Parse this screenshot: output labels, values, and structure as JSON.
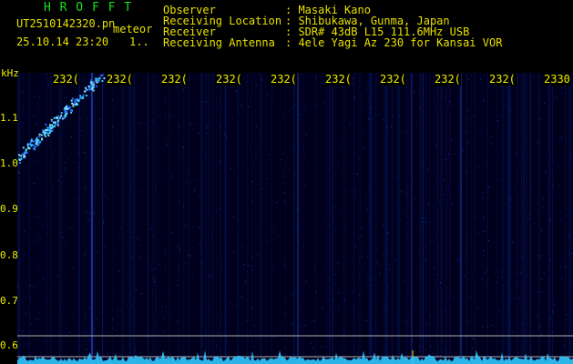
{
  "header": {
    "logo": "H R O F F T",
    "filename": "UT2510142320.pn",
    "filename_suffix": "meteor",
    "datetime": "25.10.14 23:20",
    "index": "1..",
    "info": [
      {
        "label": "Observer",
        "value": ": Masaki Kano"
      },
      {
        "label": "Receiving Location",
        "value": ": Shibukawa, Gunma, Japan"
      },
      {
        "label": "Receiver",
        "value": ": SDR# 43dB L15 111.6MHz USB"
      },
      {
        "label": "Receiving Antenna",
        "value": ": 4ele Yagi Az 230 for Kansai VOR"
      }
    ]
  },
  "plot": {
    "y_unit": "kHz",
    "y_ticks": [
      "1.1",
      "1.0",
      "0.9",
      "0.8",
      "0.7",
      "0.6"
    ],
    "x_ticks": [
      "232(",
      "232(",
      "232(",
      "232(",
      "232(",
      "232(",
      "232(",
      "232(",
      "232(",
      "2330"
    ]
  },
  "colors": {
    "background": "#000000",
    "plot_background": "#00001c",
    "labels": "#f0f000",
    "logo": "#18e018",
    "signal": "#30c8ff"
  }
}
